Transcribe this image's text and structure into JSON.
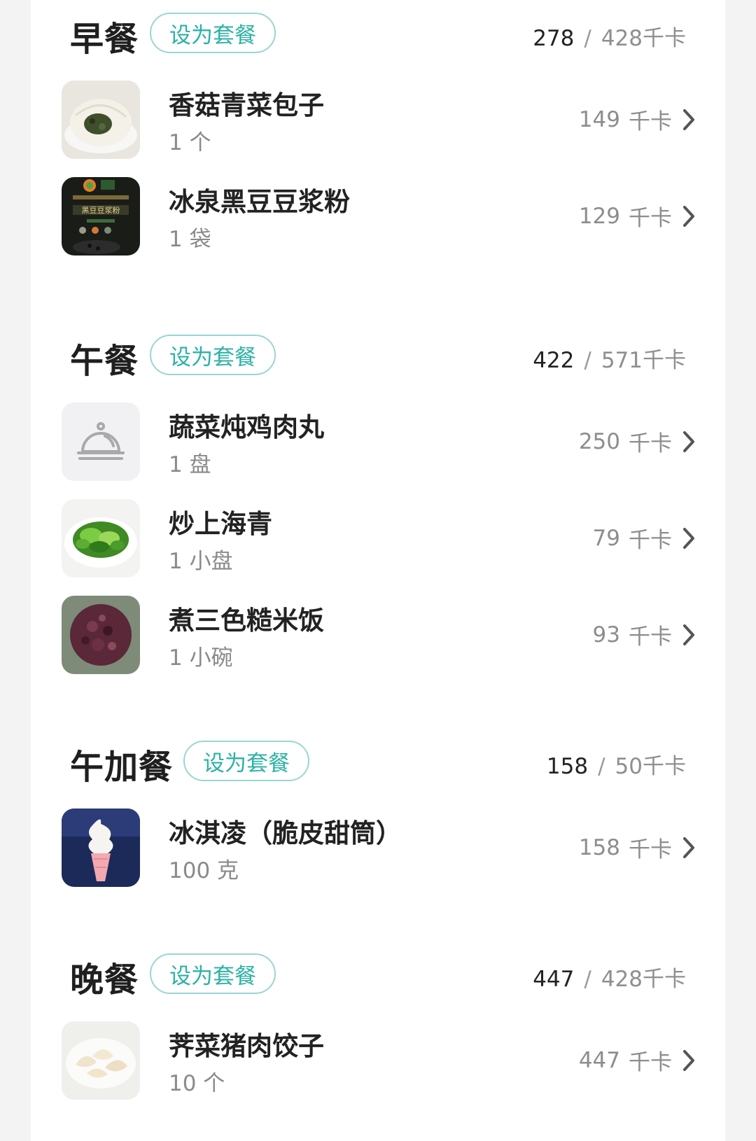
{
  "meals": [
    {
      "title": "早餐",
      "set_label": "设为套餐",
      "eaten": "278",
      "target": "428千卡",
      "items": [
        {
          "name": "香菇青菜包子",
          "qty": "1 个",
          "cal": "149",
          "unit": "千卡",
          "icon": "bun-photo"
        },
        {
          "name": "冰泉黑豆豆浆粉",
          "qty": "1 袋",
          "cal": "129",
          "unit": "千卡",
          "icon": "soy-milk-package-photo"
        }
      ]
    },
    {
      "title": "午餐",
      "set_label": "设为套餐",
      "eaten": "422",
      "target": "571千卡",
      "items": [
        {
          "name": "蔬菜炖鸡肉丸",
          "qty": "1 盘",
          "cal": "250",
          "unit": "千卡",
          "icon": "food-cloche-icon"
        },
        {
          "name": "炒上海青",
          "qty": "1 小盘",
          "cal": "79",
          "unit": "千卡",
          "icon": "greens-photo"
        },
        {
          "name": "煮三色糙米饭",
          "qty": "1 小碗",
          "cal": "93",
          "unit": "千卡",
          "icon": "rice-photo"
        }
      ]
    },
    {
      "title": "午加餐",
      "set_label": "设为套餐",
      "eaten": "158",
      "target": "50千卡",
      "items": [
        {
          "name": "冰淇凌（脆皮甜筒）",
          "qty": "100 克",
          "cal": "158",
          "unit": "千卡",
          "icon": "ice-cream-photo"
        }
      ]
    },
    {
      "title": "晚餐",
      "set_label": "设为套餐",
      "eaten": "447",
      "target": "428千卡",
      "items": [
        {
          "name": "荠菜猪肉饺子",
          "qty": "10 个",
          "cal": "447",
          "unit": "千卡",
          "icon": "dumplings-photo"
        }
      ]
    }
  ],
  "colors": {
    "accent": "#2cb2a5",
    "accent_border": "#9ad6d1",
    "muted_text": "#8d8d8d"
  }
}
